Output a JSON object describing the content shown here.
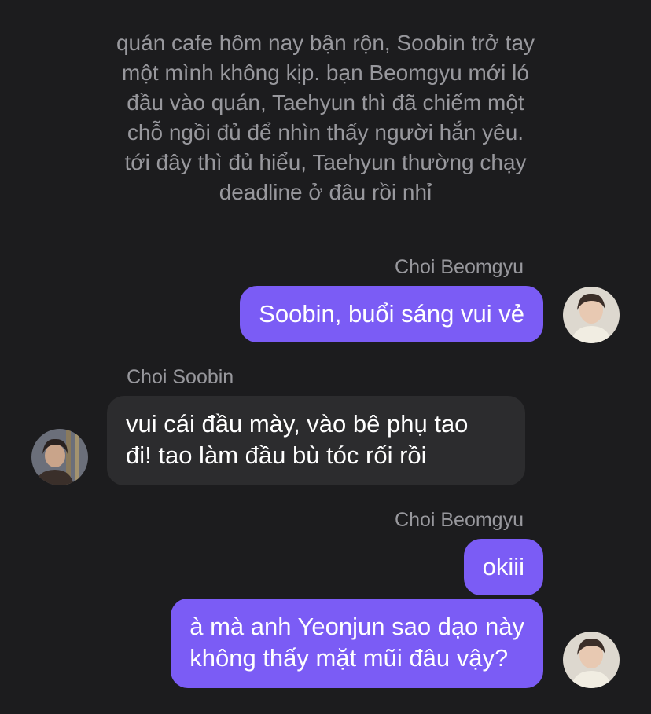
{
  "narration": "quán cafe hôm nay bận rộn, Soobin trở tay\nmột mình không kịp. bạn Beomgyu mới ló\nđầu vào quán, Taehyun thì đã chiếm một\nchỗ ngồi đủ để nhìn thấy người hắn yêu.\ntới đây thì đủ hiểu, Taehyun thường chạy\ndeadline ở đâu rồi nhỉ",
  "messages": [
    {
      "sender": "Choi Beomgyu",
      "side": "right",
      "text": "Soobin, buổi sáng vui vẻ"
    },
    {
      "sender": "Choi Soobin",
      "side": "left",
      "text": "vui cái đầu mày, vào bê phụ tao\nđi! tao làm đầu bù tóc rối rồi"
    },
    {
      "sender": "Choi Beomgyu",
      "side": "right",
      "text": "okiii"
    },
    {
      "sender": "",
      "side": "right",
      "text": "à mà anh Yeonjun sao dạo này\nkhông thấy mặt mũi đâu vậy?"
    }
  ],
  "colors": {
    "background": "#1c1c1e",
    "outgoing_bubble": "#7b5cf5",
    "incoming_bubble": "#2c2c2e",
    "secondary_text": "#98989d"
  }
}
